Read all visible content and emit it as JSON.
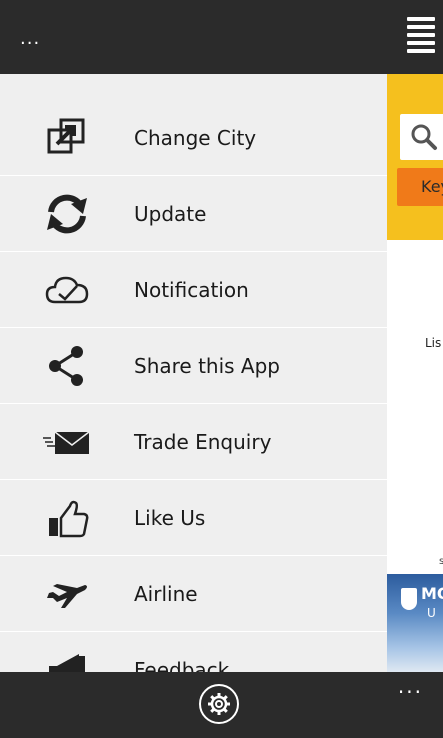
{
  "header": {
    "dots": "..."
  },
  "menu": {
    "items": [
      {
        "label": "Change City",
        "icon": "change-city-icon"
      },
      {
        "label": "Update",
        "icon": "refresh-icon"
      },
      {
        "label": "Notification",
        "icon": "cloud-check-icon"
      },
      {
        "label": "Share this App",
        "icon": "share-icon"
      },
      {
        "label": "Trade Enquiry",
        "icon": "mail-icon"
      },
      {
        "label": "Like Us",
        "icon": "thumbs-up-icon"
      },
      {
        "label": "Airline",
        "icon": "airplane-icon"
      },
      {
        "label": "Feedback",
        "icon": "megaphone-icon"
      }
    ]
  },
  "background": {
    "key_button": "Key",
    "list_text": "Lis",
    "small_text": "s",
    "banner_mo": "MO",
    "banner_u": "U"
  },
  "appbar": {
    "dots": "..."
  }
}
